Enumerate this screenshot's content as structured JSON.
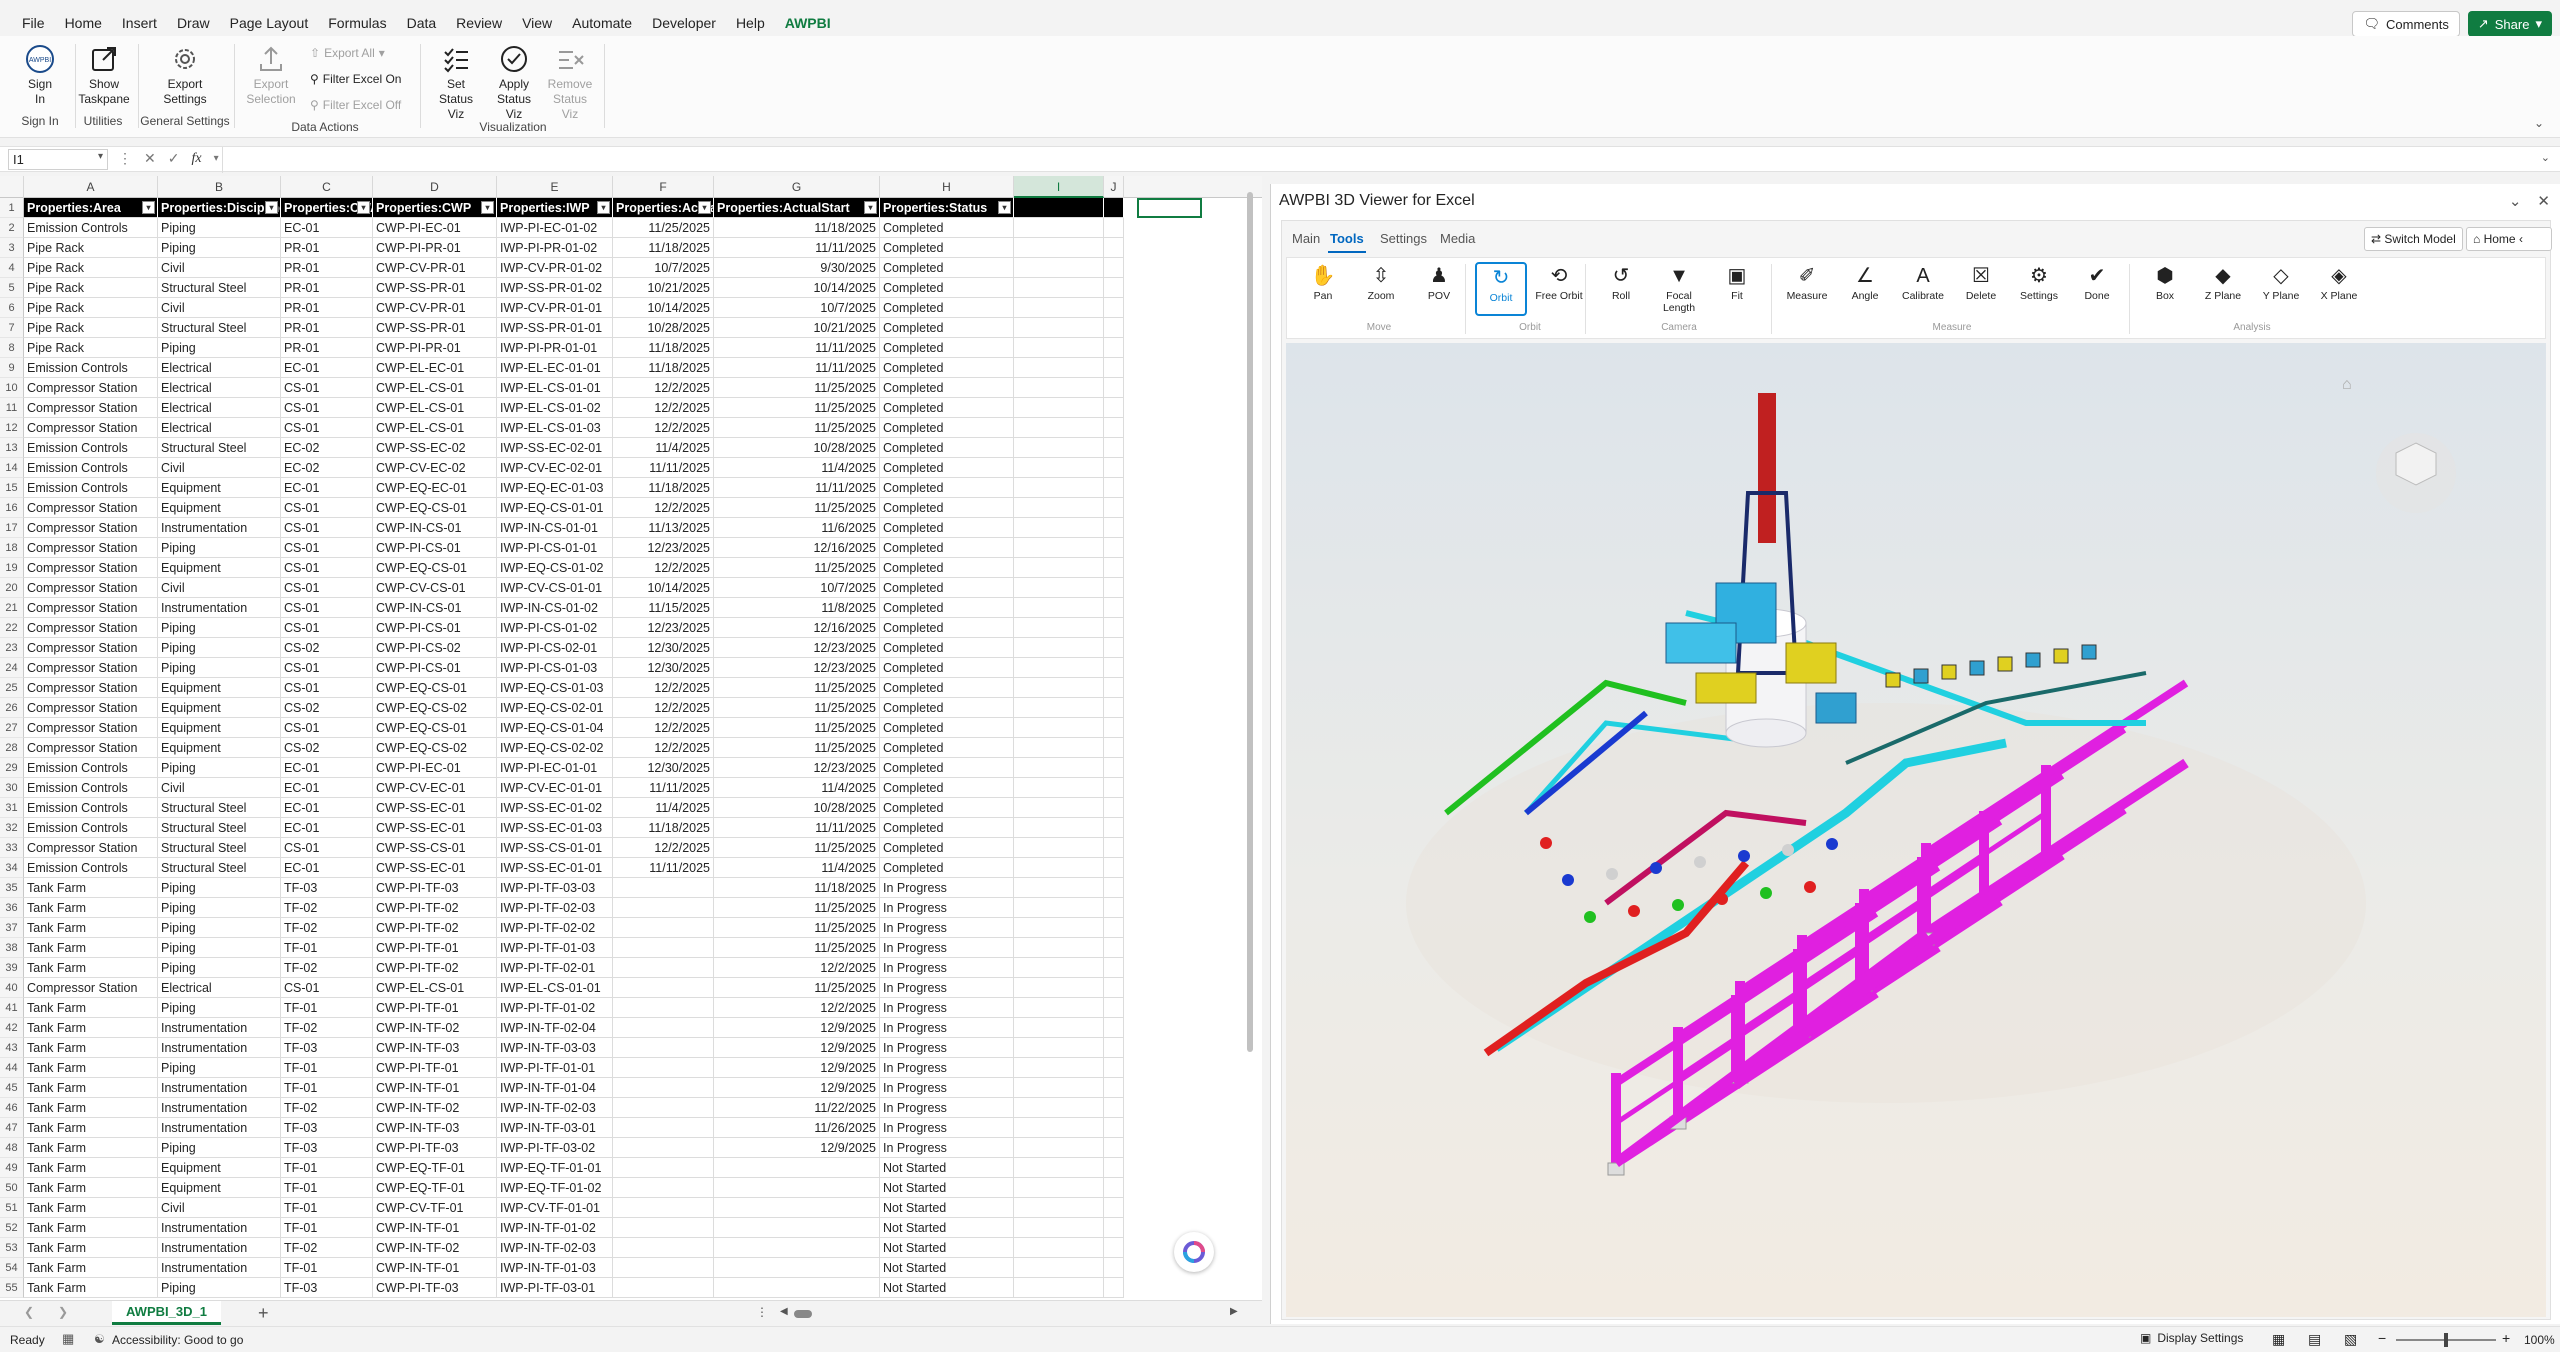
{
  "menu": {
    "items": [
      "File",
      "Home",
      "Insert",
      "Draw",
      "Page Layout",
      "Formulas",
      "Data",
      "Review",
      "View",
      "Automate",
      "Developer",
      "Help",
      "AWPBI"
    ],
    "active": "AWPBI",
    "comments_label": "Comments",
    "share_label": "Share"
  },
  "ribbon": {
    "sign_in": "Sign In",
    "sign_in_group": "Sign In",
    "show_taskpane": "Show Taskpane",
    "utilities_group": "Utilities",
    "export_settings": "Export Settings",
    "general_group": "General Settings",
    "export_selection": "Export Selection",
    "export_all": "Export All",
    "filter_on": "Filter Excel On",
    "filter_off": "Filter Excel Off",
    "data_group": "Data Actions",
    "set_status": "Set Status Viz",
    "apply_status": "Apply Status Viz",
    "remove_status": "Remove Status Viz",
    "viz_group": "Visualization"
  },
  "formula_bar": {
    "name_box": "I1",
    "fx": "fx",
    "value": ""
  },
  "grid": {
    "columns": [
      "A",
      "B",
      "C",
      "D",
      "E",
      "F",
      "G",
      "H",
      "I",
      "J"
    ],
    "selected_column": "I",
    "headers": [
      "Properties:Area",
      "Properties:Discipline",
      "Properties:CWA",
      "Properties:CWP",
      "Properties:IWP",
      "Properties:ActualFinish",
      "Properties:ActualStart",
      "Properties:Status"
    ],
    "rows": [
      [
        "Emission Controls",
        "Piping",
        "EC-01",
        "CWP-PI-EC-01",
        "IWP-PI-EC-01-02",
        "11/25/2025",
        "11/18/2025",
        "Completed"
      ],
      [
        "Pipe Rack",
        "Piping",
        "PR-01",
        "CWP-PI-PR-01",
        "IWP-PI-PR-01-02",
        "11/18/2025",
        "11/11/2025",
        "Completed"
      ],
      [
        "Pipe Rack",
        "Civil",
        "PR-01",
        "CWP-CV-PR-01",
        "IWP-CV-PR-01-02",
        "10/7/2025",
        "9/30/2025",
        "Completed"
      ],
      [
        "Pipe Rack",
        "Structural Steel",
        "PR-01",
        "CWP-SS-PR-01",
        "IWP-SS-PR-01-02",
        "10/21/2025",
        "10/14/2025",
        "Completed"
      ],
      [
        "Pipe Rack",
        "Civil",
        "PR-01",
        "CWP-CV-PR-01",
        "IWP-CV-PR-01-01",
        "10/14/2025",
        "10/7/2025",
        "Completed"
      ],
      [
        "Pipe Rack",
        "Structural Steel",
        "PR-01",
        "CWP-SS-PR-01",
        "IWP-SS-PR-01-01",
        "10/28/2025",
        "10/21/2025",
        "Completed"
      ],
      [
        "Pipe Rack",
        "Piping",
        "PR-01",
        "CWP-PI-PR-01",
        "IWP-PI-PR-01-01",
        "11/18/2025",
        "11/11/2025",
        "Completed"
      ],
      [
        "Emission Controls",
        "Electrical",
        "EC-01",
        "CWP-EL-EC-01",
        "IWP-EL-EC-01-01",
        "11/18/2025",
        "11/11/2025",
        "Completed"
      ],
      [
        "Compressor Station",
        "Electrical",
        "CS-01",
        "CWP-EL-CS-01",
        "IWP-EL-CS-01-01",
        "12/2/2025",
        "11/25/2025",
        "Completed"
      ],
      [
        "Compressor Station",
        "Electrical",
        "CS-01",
        "CWP-EL-CS-01",
        "IWP-EL-CS-01-02",
        "12/2/2025",
        "11/25/2025",
        "Completed"
      ],
      [
        "Compressor Station",
        "Electrical",
        "CS-01",
        "CWP-EL-CS-01",
        "IWP-EL-CS-01-03",
        "12/2/2025",
        "11/25/2025",
        "Completed"
      ],
      [
        "Emission Controls",
        "Structural Steel",
        "EC-02",
        "CWP-SS-EC-02",
        "IWP-SS-EC-02-01",
        "11/4/2025",
        "10/28/2025",
        "Completed"
      ],
      [
        "Emission Controls",
        "Civil",
        "EC-02",
        "CWP-CV-EC-02",
        "IWP-CV-EC-02-01",
        "11/11/2025",
        "11/4/2025",
        "Completed"
      ],
      [
        "Emission Controls",
        "Equipment",
        "EC-01",
        "CWP-EQ-EC-01",
        "IWP-EQ-EC-01-03",
        "11/18/2025",
        "11/11/2025",
        "Completed"
      ],
      [
        "Compressor Station",
        "Equipment",
        "CS-01",
        "CWP-EQ-CS-01",
        "IWP-EQ-CS-01-01",
        "12/2/2025",
        "11/25/2025",
        "Completed"
      ],
      [
        "Compressor Station",
        "Instrumentation",
        "CS-01",
        "CWP-IN-CS-01",
        "IWP-IN-CS-01-01",
        "11/13/2025",
        "11/6/2025",
        "Completed"
      ],
      [
        "Compressor Station",
        "Piping",
        "CS-01",
        "CWP-PI-CS-01",
        "IWP-PI-CS-01-01",
        "12/23/2025",
        "12/16/2025",
        "Completed"
      ],
      [
        "Compressor Station",
        "Equipment",
        "CS-01",
        "CWP-EQ-CS-01",
        "IWP-EQ-CS-01-02",
        "12/2/2025",
        "11/25/2025",
        "Completed"
      ],
      [
        "Compressor Station",
        "Civil",
        "CS-01",
        "CWP-CV-CS-01",
        "IWP-CV-CS-01-01",
        "10/14/2025",
        "10/7/2025",
        "Completed"
      ],
      [
        "Compressor Station",
        "Instrumentation",
        "CS-01",
        "CWP-IN-CS-01",
        "IWP-IN-CS-01-02",
        "11/15/2025",
        "11/8/2025",
        "Completed"
      ],
      [
        "Compressor Station",
        "Piping",
        "CS-01",
        "CWP-PI-CS-01",
        "IWP-PI-CS-01-02",
        "12/23/2025",
        "12/16/2025",
        "Completed"
      ],
      [
        "Compressor Station",
        "Piping",
        "CS-02",
        "CWP-PI-CS-02",
        "IWP-PI-CS-02-01",
        "12/30/2025",
        "12/23/2025",
        "Completed"
      ],
      [
        "Compressor Station",
        "Piping",
        "CS-01",
        "CWP-PI-CS-01",
        "IWP-PI-CS-01-03",
        "12/30/2025",
        "12/23/2025",
        "Completed"
      ],
      [
        "Compressor Station",
        "Equipment",
        "CS-01",
        "CWP-EQ-CS-01",
        "IWP-EQ-CS-01-03",
        "12/2/2025",
        "11/25/2025",
        "Completed"
      ],
      [
        "Compressor Station",
        "Equipment",
        "CS-02",
        "CWP-EQ-CS-02",
        "IWP-EQ-CS-02-01",
        "12/2/2025",
        "11/25/2025",
        "Completed"
      ],
      [
        "Compressor Station",
        "Equipment",
        "CS-01",
        "CWP-EQ-CS-01",
        "IWP-EQ-CS-01-04",
        "12/2/2025",
        "11/25/2025",
        "Completed"
      ],
      [
        "Compressor Station",
        "Equipment",
        "CS-02",
        "CWP-EQ-CS-02",
        "IWP-EQ-CS-02-02",
        "12/2/2025",
        "11/25/2025",
        "Completed"
      ],
      [
        "Emission Controls",
        "Piping",
        "EC-01",
        "CWP-PI-EC-01",
        "IWP-PI-EC-01-01",
        "12/30/2025",
        "12/23/2025",
        "Completed"
      ],
      [
        "Emission Controls",
        "Civil",
        "EC-01",
        "CWP-CV-EC-01",
        "IWP-CV-EC-01-01",
        "11/11/2025",
        "11/4/2025",
        "Completed"
      ],
      [
        "Emission Controls",
        "Structural Steel",
        "EC-01",
        "CWP-SS-EC-01",
        "IWP-SS-EC-01-02",
        "11/4/2025",
        "10/28/2025",
        "Completed"
      ],
      [
        "Emission Controls",
        "Structural Steel",
        "EC-01",
        "CWP-SS-EC-01",
        "IWP-SS-EC-01-03",
        "11/18/2025",
        "11/11/2025",
        "Completed"
      ],
      [
        "Compressor Station",
        "Structural Steel",
        "CS-01",
        "CWP-SS-CS-01",
        "IWP-SS-CS-01-01",
        "12/2/2025",
        "11/25/2025",
        "Completed"
      ],
      [
        "Emission Controls",
        "Structural Steel",
        "EC-01",
        "CWP-SS-EC-01",
        "IWP-SS-EC-01-01",
        "11/11/2025",
        "11/4/2025",
        "Completed"
      ],
      [
        "Tank Farm",
        "Piping",
        "TF-03",
        "CWP-PI-TF-03",
        "IWP-PI-TF-03-03",
        "",
        "11/18/2025",
        "In Progress"
      ],
      [
        "Tank Farm",
        "Piping",
        "TF-02",
        "CWP-PI-TF-02",
        "IWP-PI-TF-02-03",
        "",
        "11/25/2025",
        "In Progress"
      ],
      [
        "Tank Farm",
        "Piping",
        "TF-02",
        "CWP-PI-TF-02",
        "IWP-PI-TF-02-02",
        "",
        "11/25/2025",
        "In Progress"
      ],
      [
        "Tank Farm",
        "Piping",
        "TF-01",
        "CWP-PI-TF-01",
        "IWP-PI-TF-01-03",
        "",
        "11/25/2025",
        "In Progress"
      ],
      [
        "Tank Farm",
        "Piping",
        "TF-02",
        "CWP-PI-TF-02",
        "IWP-PI-TF-02-01",
        "",
        "12/2/2025",
        "In Progress"
      ],
      [
        "Compressor Station",
        "Electrical",
        "CS-01",
        "CWP-EL-CS-01",
        "IWP-EL-CS-01-01",
        "",
        "11/25/2025",
        "In Progress"
      ],
      [
        "Tank Farm",
        "Piping",
        "TF-01",
        "CWP-PI-TF-01",
        "IWP-PI-TF-01-02",
        "",
        "12/2/2025",
        "In Progress"
      ],
      [
        "Tank Farm",
        "Instrumentation",
        "TF-02",
        "CWP-IN-TF-02",
        "IWP-IN-TF-02-04",
        "",
        "12/9/2025",
        "In Progress"
      ],
      [
        "Tank Farm",
        "Instrumentation",
        "TF-03",
        "CWP-IN-TF-03",
        "IWP-IN-TF-03-03",
        "",
        "12/9/2025",
        "In Progress"
      ],
      [
        "Tank Farm",
        "Piping",
        "TF-01",
        "CWP-PI-TF-01",
        "IWP-PI-TF-01-01",
        "",
        "12/9/2025",
        "In Progress"
      ],
      [
        "Tank Farm",
        "Instrumentation",
        "TF-01",
        "CWP-IN-TF-01",
        "IWP-IN-TF-01-04",
        "",
        "12/9/2025",
        "In Progress"
      ],
      [
        "Tank Farm",
        "Instrumentation",
        "TF-02",
        "CWP-IN-TF-02",
        "IWP-IN-TF-02-03",
        "",
        "11/22/2025",
        "In Progress"
      ],
      [
        "Tank Farm",
        "Instrumentation",
        "TF-03",
        "CWP-IN-TF-03",
        "IWP-IN-TF-03-01",
        "",
        "11/26/2025",
        "In Progress"
      ],
      [
        "Tank Farm",
        "Piping",
        "TF-03",
        "CWP-PI-TF-03",
        "IWP-PI-TF-03-02",
        "",
        "12/9/2025",
        "In Progress"
      ],
      [
        "Tank Farm",
        "Equipment",
        "TF-01",
        "CWP-EQ-TF-01",
        "IWP-EQ-TF-01-01",
        "",
        "",
        "Not Started"
      ],
      [
        "Tank Farm",
        "Equipment",
        "TF-01",
        "CWP-EQ-TF-01",
        "IWP-EQ-TF-01-02",
        "",
        "",
        "Not Started"
      ],
      [
        "Tank Farm",
        "Civil",
        "TF-01",
        "CWP-CV-TF-01",
        "IWP-CV-TF-01-01",
        "",
        "",
        "Not Started"
      ],
      [
        "Tank Farm",
        "Instrumentation",
        "TF-01",
        "CWP-IN-TF-01",
        "IWP-IN-TF-01-02",
        "",
        "",
        "Not Started"
      ],
      [
        "Tank Farm",
        "Instrumentation",
        "TF-02",
        "CWP-IN-TF-02",
        "IWP-IN-TF-02-03",
        "",
        "",
        "Not Started"
      ],
      [
        "Tank Farm",
        "Instrumentation",
        "TF-01",
        "CWP-IN-TF-01",
        "IWP-IN-TF-01-03",
        "",
        "",
        "Not Started"
      ],
      [
        "Tank Farm",
        "Piping",
        "TF-03",
        "CWP-PI-TF-03",
        "IWP-PI-TF-03-01",
        "",
        "",
        "Not Started"
      ]
    ]
  },
  "sheet": {
    "tab": "AWPBI_3D_1"
  },
  "status": {
    "ready": "Ready",
    "accessibility": "Accessibility: Good to go",
    "display_settings": "Display Settings",
    "zoom": "100%"
  },
  "pane": {
    "title": "AWPBI 3D Viewer for Excel",
    "tabs": [
      "Main",
      "Tools",
      "Settings",
      "Media"
    ],
    "active_tab": "Tools",
    "switch_model": "Switch Model",
    "home": "Home",
    "tools": [
      {
        "label": "Pan",
        "icon": "hand-icon"
      },
      {
        "label": "Zoom",
        "icon": "zoom-icon"
      },
      {
        "label": "POV",
        "icon": "person-icon"
      },
      {
        "label": "Orbit",
        "icon": "orbit-icon"
      },
      {
        "label": "Free Orbit",
        "icon": "free-orbit-icon"
      },
      {
        "label": "Roll",
        "icon": "roll-icon"
      },
      {
        "label": "Focal Length",
        "icon": "focal-length-icon"
      },
      {
        "label": "Fit",
        "icon": "camera-icon"
      },
      {
        "label": "Measure",
        "icon": "ruler-icon"
      },
      {
        "label": "Angle",
        "icon": "angle-icon"
      },
      {
        "label": "Calibrate",
        "icon": "calibrate-icon"
      },
      {
        "label": "Delete",
        "icon": "trash-icon"
      },
      {
        "label": "Settings",
        "icon": "settings-icon"
      },
      {
        "label": "Done",
        "icon": "check-icon"
      },
      {
        "label": "Box",
        "icon": "box-icon"
      },
      {
        "label": "Z Plane",
        "icon": "z-plane-icon"
      },
      {
        "label": "Y Plane",
        "icon": "y-plane-icon"
      },
      {
        "label": "X Plane",
        "icon": "x-plane-icon"
      }
    ],
    "active_tool": "Orbit",
    "groups": [
      "Move",
      "Orbit",
      "Camera",
      "Measure",
      "Analysis"
    ]
  },
  "colors": {
    "excel_green": "#107c41",
    "accent_blue": "#0a84d6",
    "structure": "#e020e0",
    "pipe_cyan": "#20d0e0",
    "stack": "#c02020",
    "equipment": "#30b0e0"
  }
}
